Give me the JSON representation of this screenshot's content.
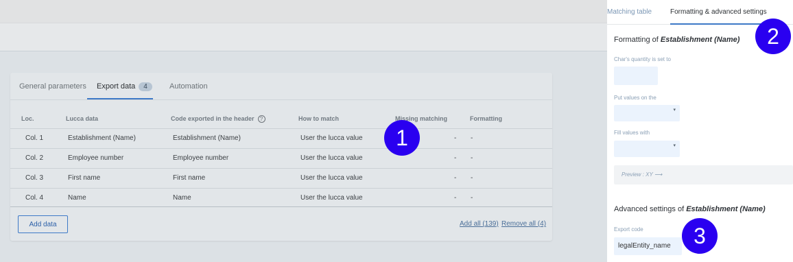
{
  "tabs": {
    "general": "General parameters",
    "export": "Export data",
    "export_count": "4",
    "automation": "Automation"
  },
  "table": {
    "headers": {
      "loc": "Loc.",
      "lucca_data": "Lucca data",
      "code": "Code exported in the header",
      "how": "How to match",
      "missing": "Missing matching",
      "formatting": "Formatting"
    },
    "rows": [
      {
        "loc": "Col. 1",
        "lucca": "Establishment (Name)",
        "code": "Establishment (Name)",
        "how": "User the lucca value",
        "missing": "-",
        "formatting": "-"
      },
      {
        "loc": "Col. 2",
        "lucca": "Employee number",
        "code": "Employee number",
        "how": "User the lucca value",
        "missing": "-",
        "formatting": "-"
      },
      {
        "loc": "Col. 3",
        "lucca": "First name",
        "code": "First name",
        "how": "User the lucca value",
        "missing": "-",
        "formatting": "-"
      },
      {
        "loc": "Col. 4",
        "lucca": "Name",
        "code": "Name",
        "how": "User the lucca value",
        "missing": "-",
        "formatting": "-"
      }
    ]
  },
  "actions": {
    "add_data": "Add data",
    "add_all": "Add all (139)",
    "remove_all": "Remove all (4)"
  },
  "panel": {
    "tab_matching": "Matching table",
    "tab_formatting": "Formatting & advanced settings",
    "formatting_prefix": "Formatting of ",
    "field_name": "Establishment (Name)",
    "chars_label": "Char's quantity is set to",
    "put_values_label": "Put values on the",
    "fill_values_label": "Fill values with",
    "preview": "Preview : XY ⟶",
    "advanced_prefix": "Advanced settings of ",
    "export_code_label": "Export code",
    "export_code_value": "legalEntity_name"
  },
  "markers": [
    "1",
    "2",
    "3"
  ],
  "icons": {
    "help": "help-circle-icon",
    "caret": "caret-down-icon"
  },
  "colors": {
    "accent": "#3d79c7",
    "marker": "#2a00f0"
  }
}
